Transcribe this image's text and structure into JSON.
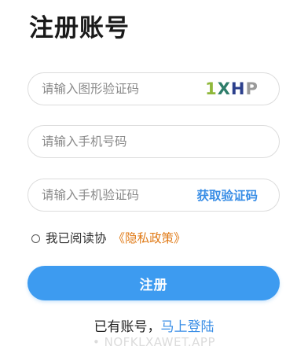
{
  "page": {
    "title": "注册账号"
  },
  "form": {
    "captcha": {
      "placeholder": "请输入图形验证码",
      "value": "",
      "image_text": [
        "1",
        "X",
        "H",
        "P"
      ]
    },
    "phone": {
      "placeholder": "请输入手机号码",
      "value": ""
    },
    "sms": {
      "placeholder": "请输入手机验证码",
      "value": "",
      "button_label": "获取验证码"
    }
  },
  "agreement": {
    "checked": false,
    "text": "我已阅读协",
    "policy_link": "《隐私政策》"
  },
  "register_button": {
    "label": "注册"
  },
  "login_prompt": {
    "text": "已有账号，",
    "link": "马上登陆"
  },
  "watermark": {
    "text": "• NOFKLXAWET.APP"
  },
  "colors": {
    "accent": "#3d9bf0",
    "link": "#3a8ee6",
    "policy": "#e07b18",
    "border": "#dcdcdc"
  },
  "icons": {
    "agreement_radio": "radio-circle-icon"
  }
}
